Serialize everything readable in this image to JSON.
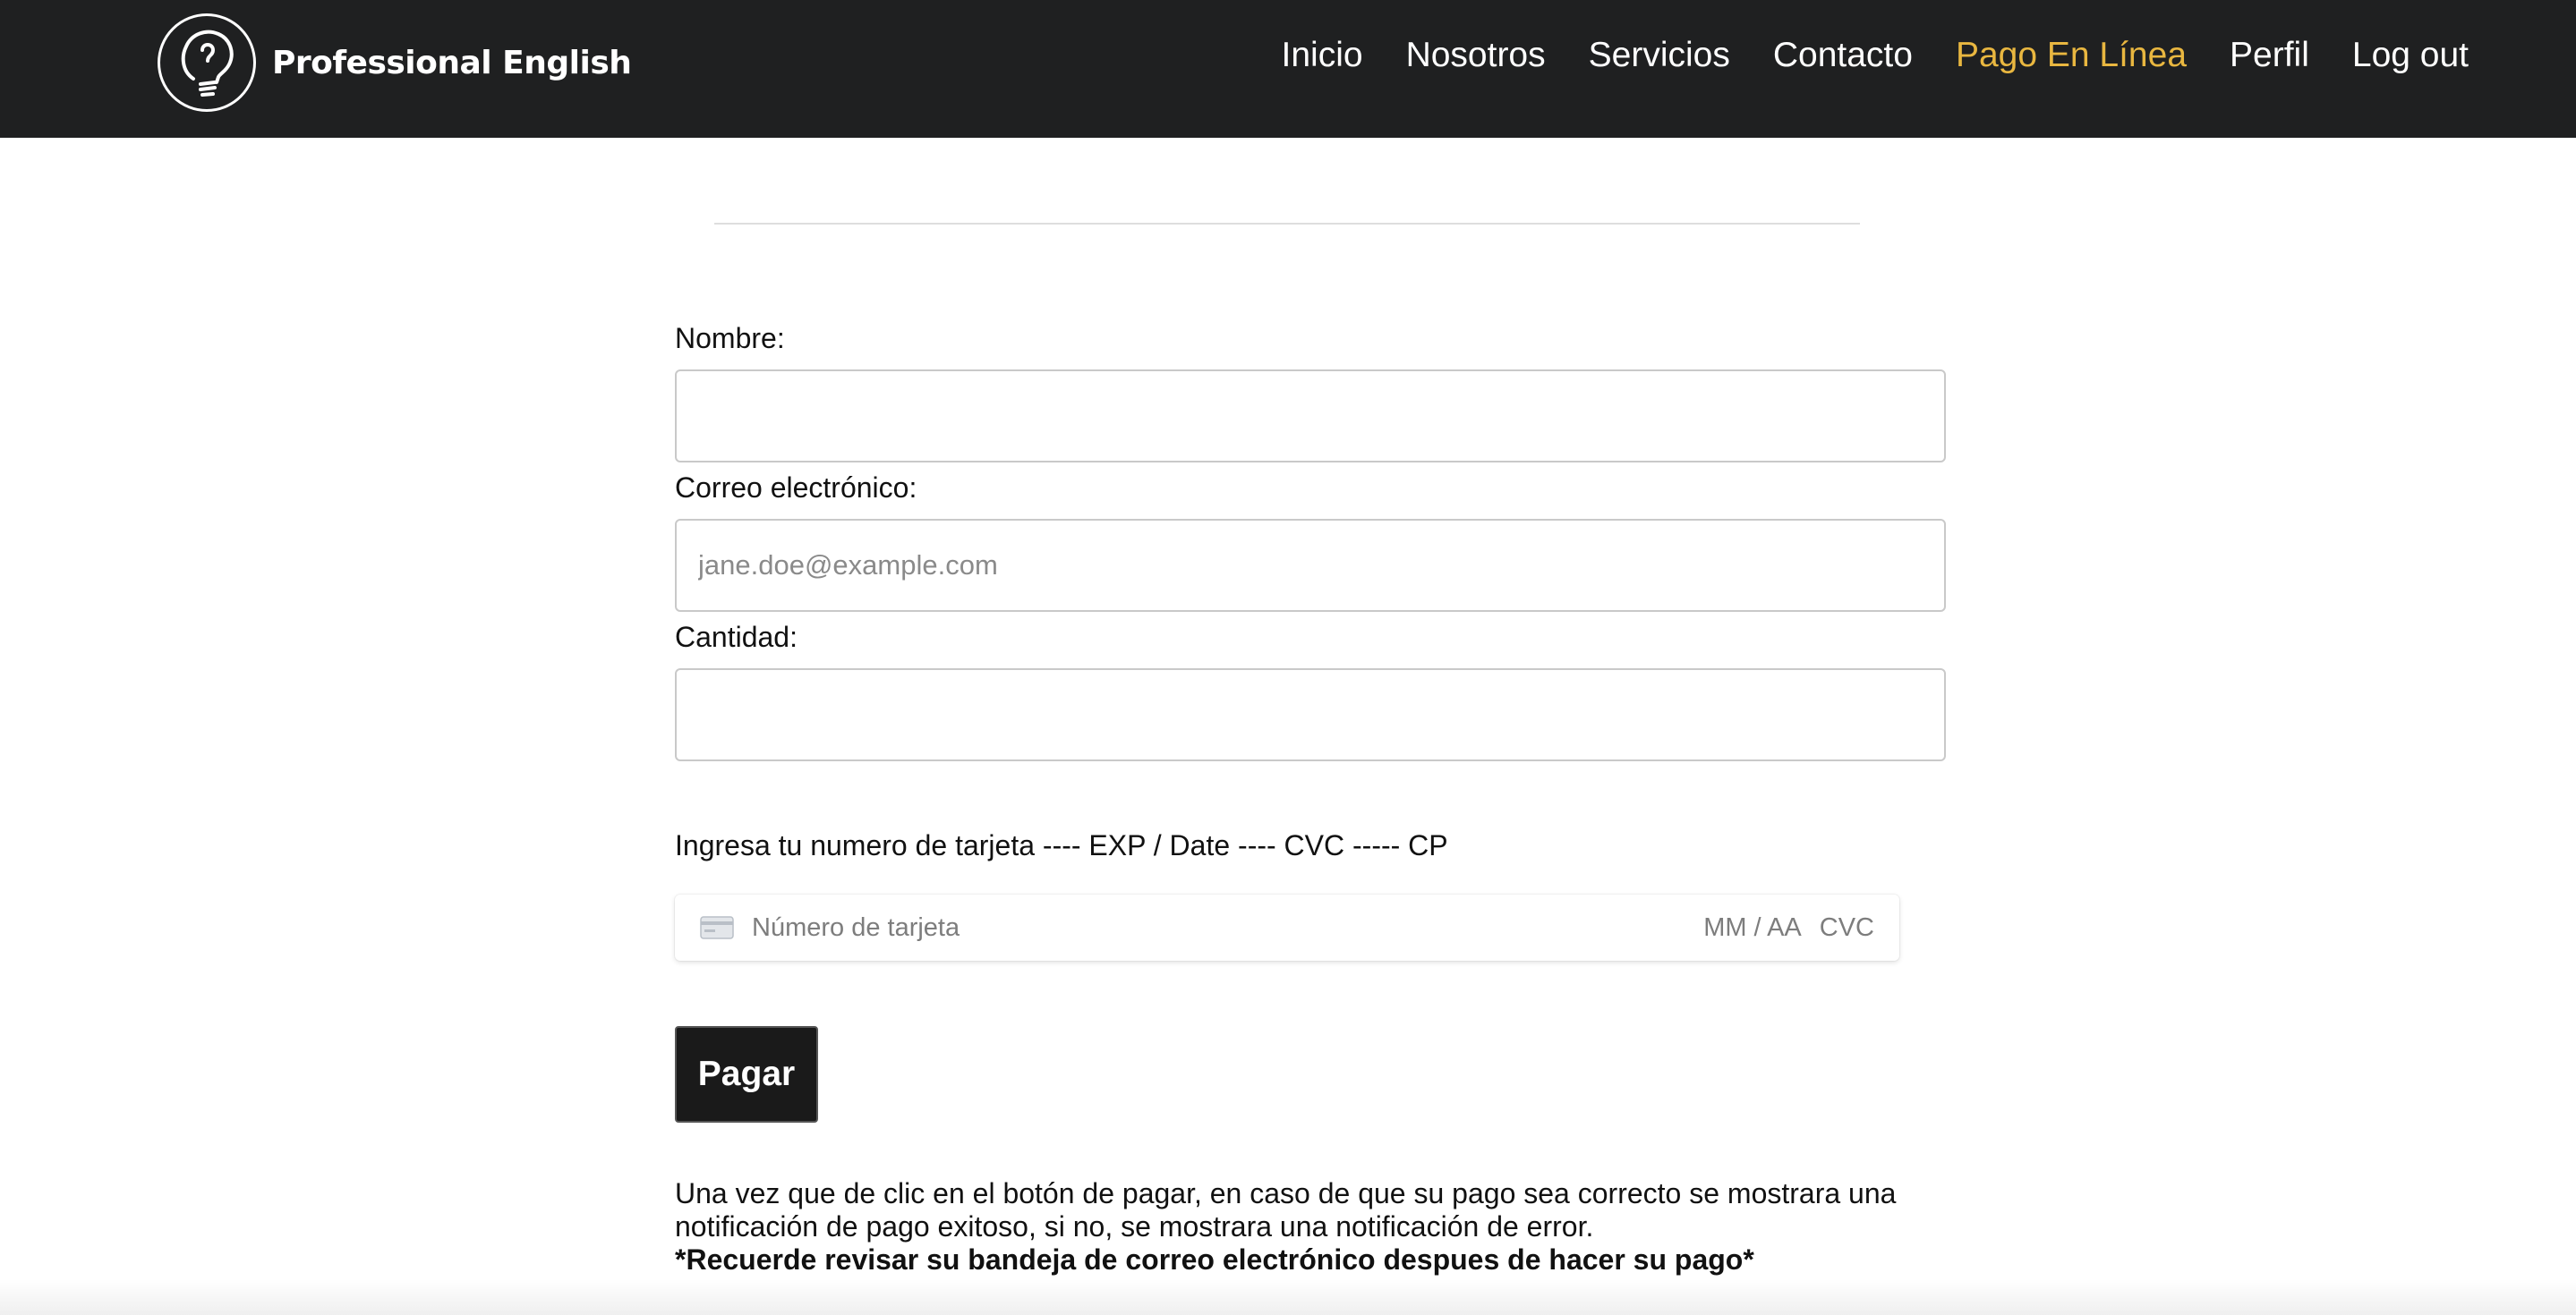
{
  "brand": {
    "name": "Professional English",
    "icon": "head-lightbulb-logo-icon"
  },
  "nav": {
    "items": [
      {
        "label": "Inicio",
        "active": false
      },
      {
        "label": "Nosotros",
        "active": false
      },
      {
        "label": "Servicios",
        "active": false
      },
      {
        "label": "Contacto",
        "active": false
      },
      {
        "label": "Pago En Línea",
        "active": true
      },
      {
        "label": "Perfil",
        "active": false
      },
      {
        "label": "Log out",
        "active": false
      }
    ],
    "active_color": "#e9b740"
  },
  "form": {
    "name_label": "Nombre:",
    "name_value": "",
    "email_label": "Correo electrónico:",
    "email_placeholder": "jane.doe@example.com",
    "amount_label": "Cantidad:",
    "amount_value": ""
  },
  "card": {
    "instructions": "Ingresa tu numero de tarjeta ---- EXP / Date ---- CVC ----- CP",
    "number_placeholder": "Número de tarjeta",
    "expiry_placeholder": "MM / AA",
    "cvc_placeholder": "CVC",
    "icon": "credit-card-icon"
  },
  "pay_button": {
    "label": "Pagar"
  },
  "info": {
    "line": "Una vez que de clic en el botón de pagar, en caso de que su pago sea correcto se mostrara una notificación de pago exitoso, si no, se mostrara una notificación de error.",
    "reminder": "*Recuerde revisar su bandeja de correo electrónico despues de hacer su pago*"
  }
}
